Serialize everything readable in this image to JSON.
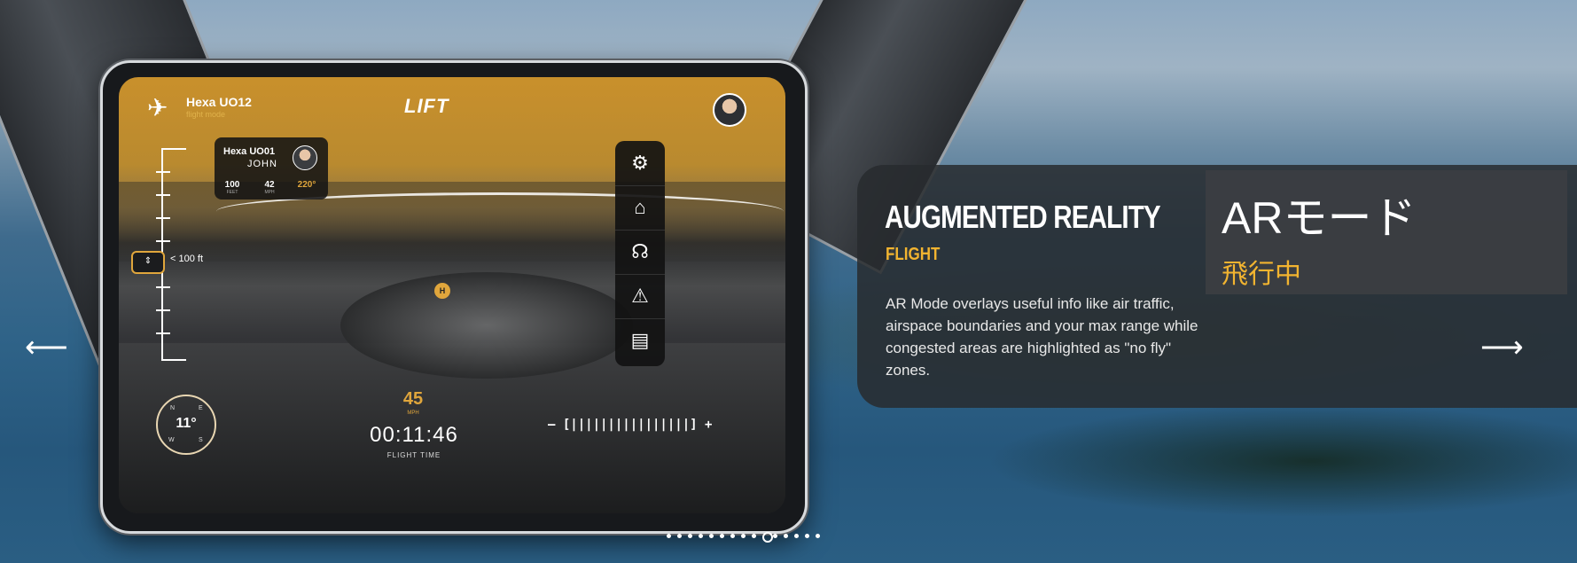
{
  "tablet": {
    "aircraft_name": "Hexa UO12",
    "aircraft_mode": "flight mode",
    "logo": "LIFT",
    "traffic": {
      "name": "Hexa UO01",
      "pilot": "JOHN",
      "stats": [
        {
          "value": "100",
          "unit": "FEET"
        },
        {
          "value": "42",
          "unit": "MPH"
        },
        {
          "value": "220°",
          "unit": ""
        }
      ]
    },
    "altitude_label": "< 100 ft",
    "altitude_marker": "⇕",
    "heliport_marker": "H",
    "toolbar": [
      {
        "name": "settings-icon",
        "glyph": "⚙"
      },
      {
        "name": "home-icon",
        "glyph": "⌂"
      },
      {
        "name": "support-headset-icon",
        "glyph": "☊"
      },
      {
        "name": "warning-icon",
        "glyph": "⚠"
      },
      {
        "name": "map-icon",
        "glyph": "▤"
      }
    ],
    "compass": {
      "heading": "11°",
      "n": "N",
      "e": "E",
      "s": "S",
      "w": "W"
    },
    "speed": "45",
    "speed_unit": "MPH",
    "flight_time": "00:11:46",
    "flight_time_label": "FLIGHT TIME",
    "zoom_control": "– [||||||||||||||||] +"
  },
  "info_panel": {
    "title": "AUGMENTED REALITY",
    "subtitle": "FLIGHT",
    "body": "AR Mode overlays useful info like air traffic, airspace boundaries and your max range while congested areas are highlighted as \"no fly\" zones."
  },
  "translation_box": {
    "title": "ARモード",
    "subtitle": "飛行中"
  },
  "carousel": {
    "prev_arrow": "⟵",
    "next_arrow": "⟶",
    "dot_count": 15,
    "active_index": 9
  },
  "colors": {
    "accent": "#f2b430",
    "panel": "#2b2e32"
  }
}
